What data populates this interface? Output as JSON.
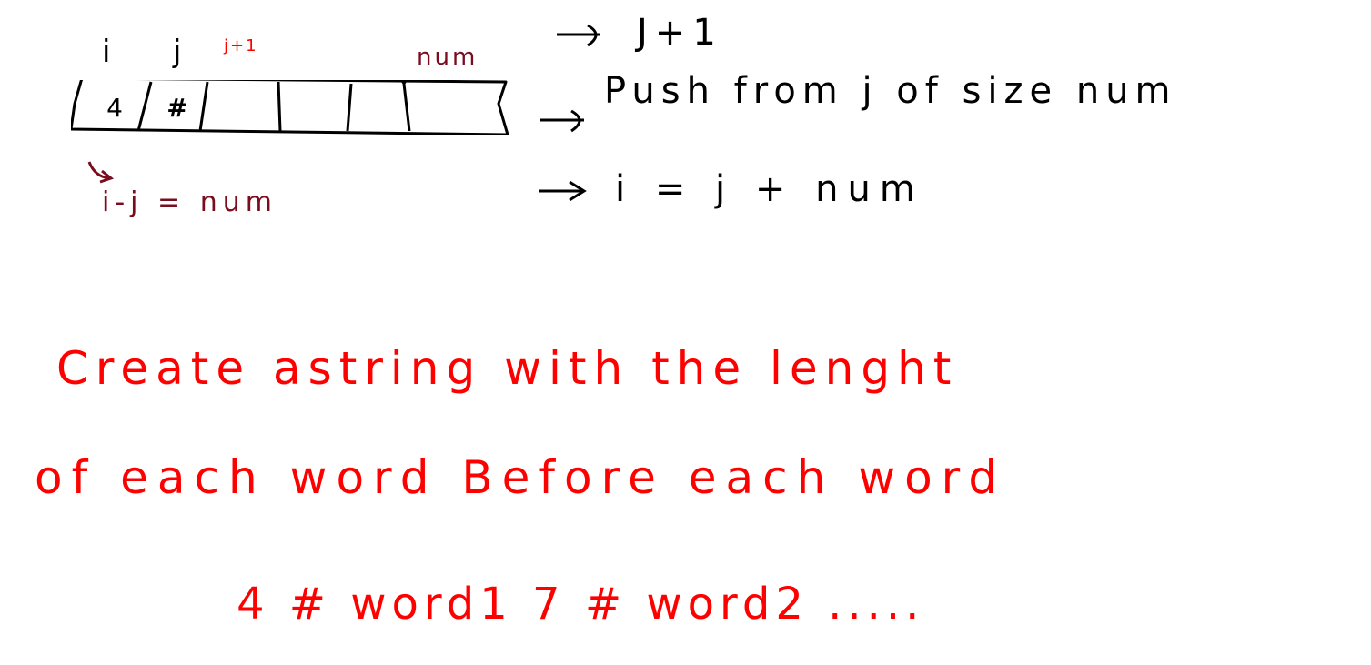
{
  "diagram": {
    "array_labels": {
      "i": "i",
      "j": "j",
      "j_plus_1": "j+1",
      "num": "num"
    },
    "array_cells": [
      "4",
      "#",
      "",
      "",
      "",
      ""
    ],
    "below_array": "i-j = num",
    "steps": [
      "J+1",
      "Push from j of size num",
      "i = j + num"
    ],
    "notes": {
      "line1": "Create astring with the lenght",
      "line2": "of each word Before each word",
      "example": "4 # word1 7 # word2 ....."
    }
  },
  "colors": {
    "ink": "#000000",
    "maroon": "#7a0c1e",
    "red": "#ff0000"
  }
}
